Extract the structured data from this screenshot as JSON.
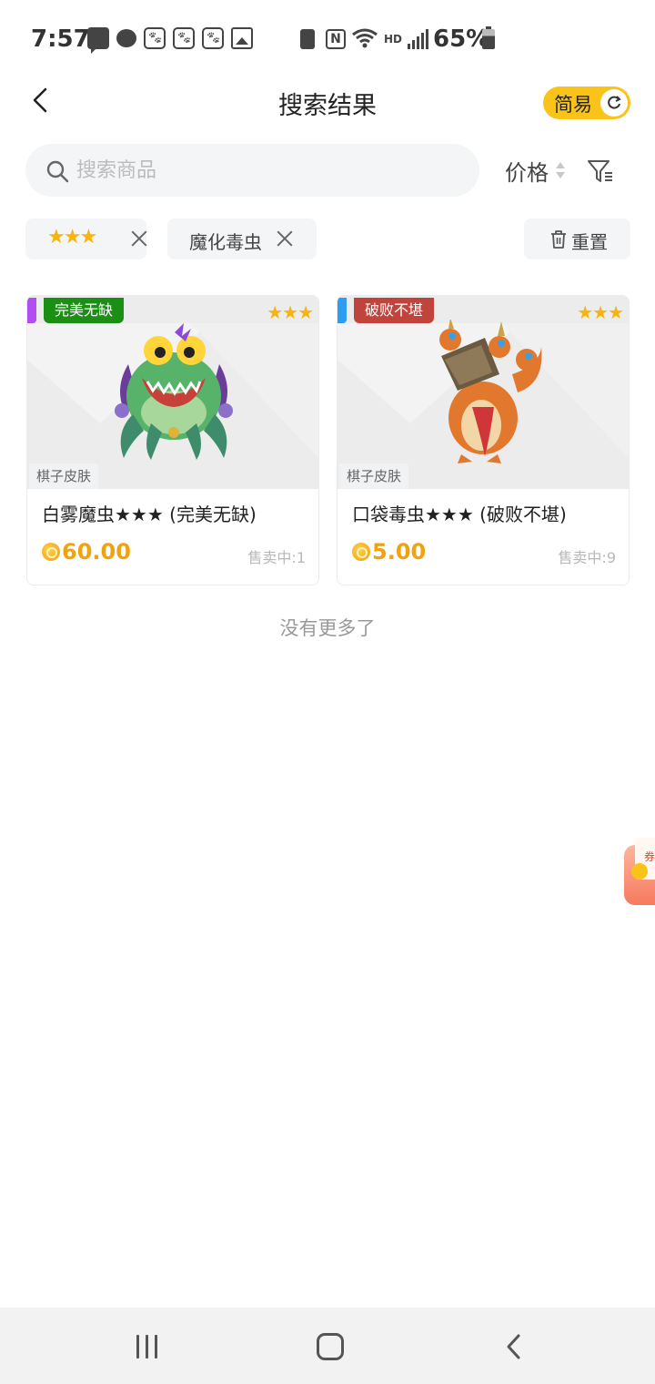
{
  "status_bar": {
    "time": "7:57",
    "battery": "65%",
    "network_label": "HD",
    "icons": [
      "message-icon",
      "wechat-icon",
      "paw-icon",
      "paw-icon",
      "paw-icon",
      "gallery-icon",
      "battery-saver-icon",
      "nfc-icon",
      "wifi-icon",
      "signal-icon",
      "battery-icon"
    ]
  },
  "header": {
    "back_icon": "back-arrow-icon",
    "title": "搜索结果",
    "mode_toggle_label": "简易",
    "mode_toggle_icon": "refresh-icon"
  },
  "search": {
    "placeholder": "搜索商品",
    "value": "",
    "sort_label": "价格",
    "filter_icon": "filter-icon"
  },
  "filters": {
    "chips": [
      {
        "label": "★★★",
        "close_icon": "close-icon"
      },
      {
        "label": "魔化毒虫",
        "close_icon": "close-icon"
      }
    ],
    "reset_label": "重置",
    "reset_icon": "trash-icon"
  },
  "products": [
    {
      "name": "白雾魔虫★★★ (完美无缺)",
      "condition": "完美无缺",
      "stars": "★★★",
      "tag": "棋子皮肤",
      "price": "60.00",
      "sold": "售卖中:1",
      "rarity_color": "#b04ef0",
      "condition_color": "#1a8f14"
    },
    {
      "name": "口袋毒虫★★★ (破败不堪)",
      "condition": "破败不堪",
      "stars": "★★★",
      "tag": "棋子皮肤",
      "price": "5.00",
      "sold": "售卖中:9",
      "rarity_color": "#2c9df0",
      "condition_color": "#c0443c"
    }
  ],
  "no_more_text": "没有更多了",
  "floating_coupon": {
    "label": "券"
  },
  "nav_bar": {
    "recent_icon": "recent-apps-icon",
    "home_icon": "home-icon",
    "back_icon": "back-icon"
  },
  "colors": {
    "accent": "#f9c31a",
    "price": "#f2a30b",
    "star": "#f7b40d"
  }
}
